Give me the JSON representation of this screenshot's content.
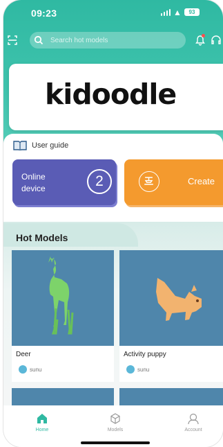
{
  "status": {
    "time": "09:23",
    "battery": "93"
  },
  "search": {
    "placeholder": "Search hot models"
  },
  "banner": {
    "logo": "kidoodle"
  },
  "guide": {
    "label": "User guide"
  },
  "device_tile": {
    "label": "Online device",
    "count": "2"
  },
  "create_tile": {
    "label": "Create"
  },
  "hot_models": {
    "title": "Hot Models",
    "items": [
      {
        "name": "Deer",
        "author": "sunu"
      },
      {
        "name": "Activity puppy",
        "author": "sunu"
      }
    ]
  },
  "tabs": [
    {
      "label": "Home",
      "icon": "home-icon",
      "active": true
    },
    {
      "label": "Models",
      "icon": "cube-icon",
      "active": false
    },
    {
      "label": "Account",
      "icon": "account-icon",
      "active": false
    }
  ],
  "colors": {
    "accent": "#2fb9a2",
    "device_tile": "#5a5cb5",
    "create_tile": "#f49a2e",
    "model_bg": "#4f86ab"
  }
}
